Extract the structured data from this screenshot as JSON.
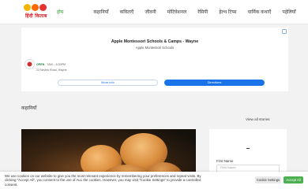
{
  "header": {
    "logo_text": "हिंदी किताब",
    "nav": [
      "होम",
      "कहानियाँ",
      "कविताएँ",
      "जीवनी",
      "मोटिवेशनल",
      "रेसिपी",
      "हेल्थ टिप्स",
      "धार्मिक कथाएँ",
      "पहेलियाँ"
    ]
  },
  "ad": {
    "title": "Apple Montessori Schools & Camps - Wayne",
    "subtitle": "Apple Montessori Schools",
    "open_label": "OPEN",
    "hours": "7AM – 6:30PM",
    "address": "23 Nevins Road, Wayne",
    "more_info": "More info",
    "directions": "Directions"
  },
  "section": {
    "title": "कहानियाँ",
    "view_all": "View all stories"
  },
  "sidebar": {
    "first_name_label": "First Name",
    "first_name_placeholder": "First Name"
  },
  "cookie": {
    "text": "We use cookies on our website to give you the most relevant experience by remembering your preferences and repeat visits. By clicking \"Accept All\", you consent to the use of ALL the cookies. However, you may visit \"Cookie Settings\" to provide a controlled consent.",
    "settings_label": "Cookie Settings",
    "accept_label": "Accept All"
  },
  "colors": {
    "nav_active": "#2a9d2a",
    "accept_button": "#4caf50",
    "directions_button": "#1a73e8",
    "open_status": "#188038"
  }
}
